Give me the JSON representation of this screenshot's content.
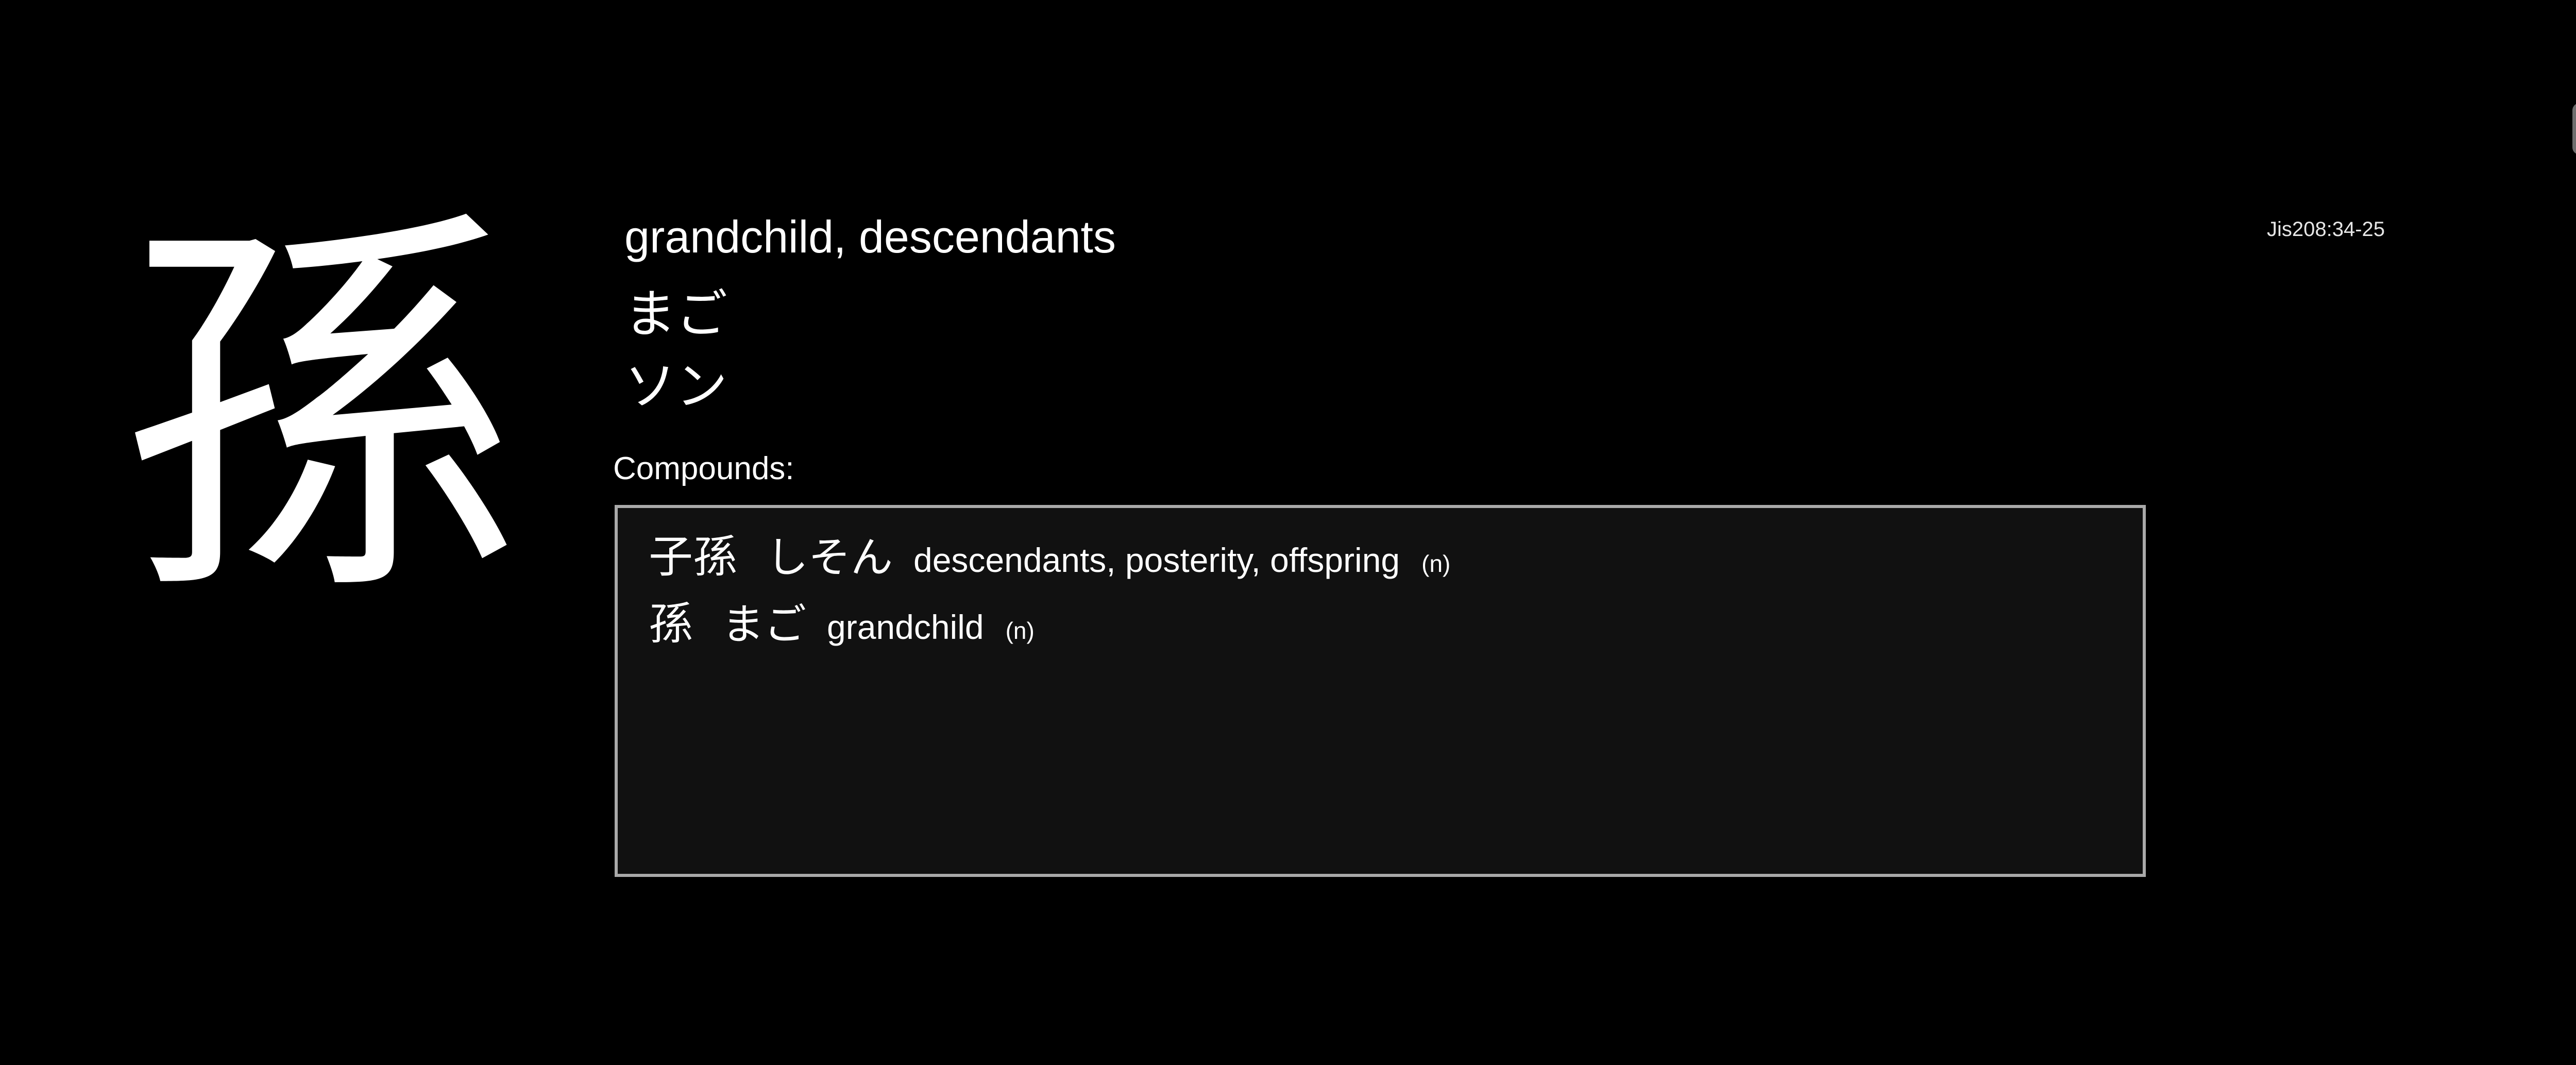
{
  "kanji": {
    "character": "孫",
    "meaning": "grandchild, descendants",
    "kun_reading": "まご",
    "on_reading": "ソン",
    "jis_code": "Jis208:34-25"
  },
  "compounds": {
    "label": "Compounds:",
    "items": [
      {
        "word": "子孫",
        "reading": "しそん",
        "gloss": "descendants, posterity, offspring",
        "pos": "(n)"
      },
      {
        "word": "孫",
        "reading": "まご",
        "gloss": "grandchild",
        "pos": "(n)"
      }
    ]
  },
  "colors": {
    "background": "#000000",
    "text": "#ffffff",
    "box_background": "#111111",
    "box_border": "#a9a9a9"
  }
}
